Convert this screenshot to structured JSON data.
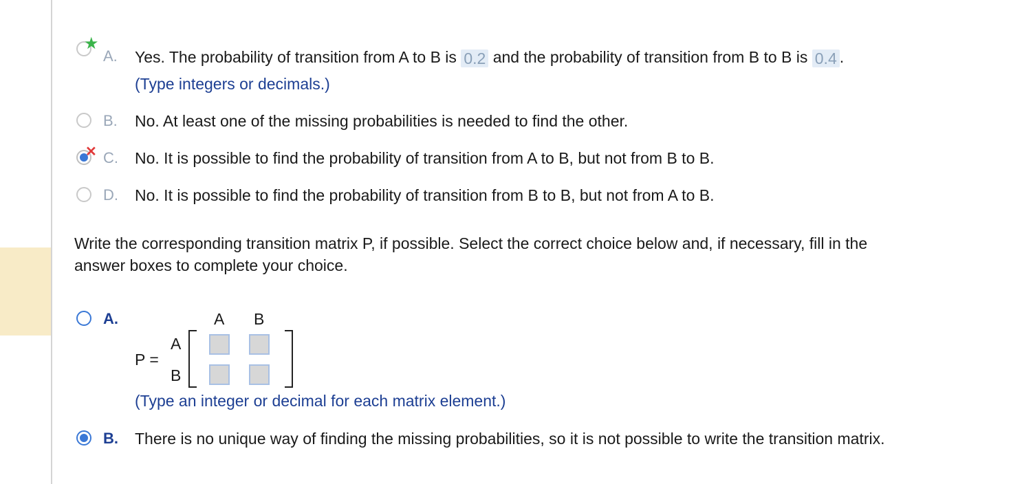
{
  "question1": {
    "options": [
      {
        "letter": "A.",
        "text_before": "Yes. The probability of transition from A to B is",
        "answer1": "0.2",
        "text_middle": "and the probability of transition from B to B is",
        "answer2": "0.4",
        "text_after": ".",
        "hint": "(Type integers or decimals.)"
      },
      {
        "letter": "B.",
        "text": "No. At least one of the missing probabilities is needed to find the other."
      },
      {
        "letter": "C.",
        "text": "No. It is possible to find the probability of transition from A to B, but not from B to B."
      },
      {
        "letter": "D.",
        "text": "No. It is possible to find the probability of transition from B to B, but not from A to B."
      }
    ]
  },
  "question2": {
    "prompt_line1": "Write the corresponding transition matrix P, if possible. Select the correct choice below and, if necessary, fill in the",
    "prompt_line2": "answer boxes to complete your choice.",
    "optionA": {
      "letter": "A.",
      "matrix_label": "P =",
      "col_headers": [
        "A",
        "B"
      ],
      "row_headers": [
        "A",
        "B"
      ],
      "hint": "(Type an integer or decimal for each matrix element.)"
    },
    "optionB": {
      "letter": "B.",
      "text": "There is no unique way of finding the missing probabilities, so it is not possible to write the transition matrix."
    }
  },
  "colors": {
    "highlight": "#f8ebc7",
    "accent": "#3a78d6",
    "hint": "#1d3f93",
    "correct": "#3ab44a",
    "wrong": "#e13a3a"
  }
}
